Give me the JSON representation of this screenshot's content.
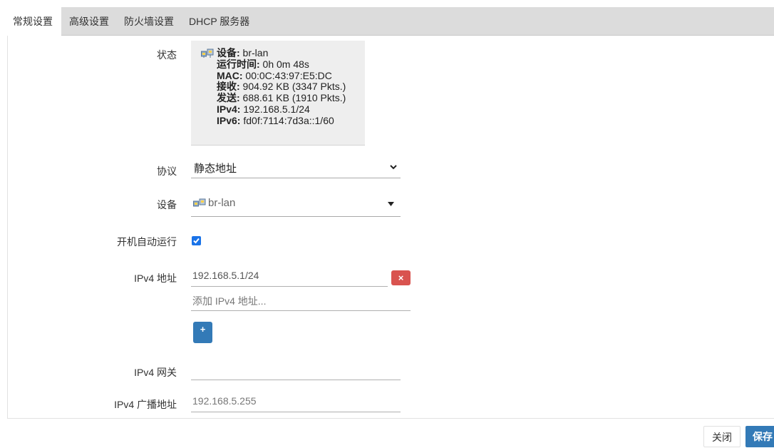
{
  "tabs": [
    {
      "label": "常规设置",
      "active": true
    },
    {
      "label": "高级设置",
      "active": false
    },
    {
      "label": "防火墙设置",
      "active": false
    },
    {
      "label": "DHCP 服务器",
      "active": false
    }
  ],
  "status": {
    "label": "状态",
    "device_key": "设备:",
    "device_val": " br-lan",
    "uptime_key": "运行时间:",
    "uptime_val": " 0h 0m 48s",
    "mac_key": "MAC:",
    "mac_val": " 00:0C:43:97:E5:DC",
    "rx_key": "接收:",
    "rx_val": " 904.92 KB (3347 Pkts.)",
    "tx_key": "发送:",
    "tx_val": " 688.61 KB (1910 Pkts.)",
    "ipv4_key": "IPv4:",
    "ipv4_val": " 192.168.5.1/24",
    "ipv6_key": "IPv6:",
    "ipv6_val": " fd0f:7114:7d3a::1/60"
  },
  "protocol": {
    "label": "协议",
    "value": "静态地址"
  },
  "device": {
    "label": "设备",
    "value": "br-lan"
  },
  "autostart": {
    "label": "开机自动运行",
    "checked": true
  },
  "ipv4_address": {
    "label": "IPv4 地址",
    "value": "192.168.5.1/24",
    "remove_label": "×",
    "placeholder": "添加 IPv4 地址...",
    "add_label": "+"
  },
  "ipv4_gateway": {
    "label": "IPv4 网关",
    "value": ""
  },
  "ipv4_broadcast": {
    "label": "IPv4 广播地址",
    "placeholder": "192.168.5.255"
  },
  "footer": {
    "close_label": "关闭",
    "save_label": "保存"
  },
  "colors": {
    "accent": "#337ab7",
    "danger": "#d9534f",
    "checkbox": "#1a73e8"
  }
}
